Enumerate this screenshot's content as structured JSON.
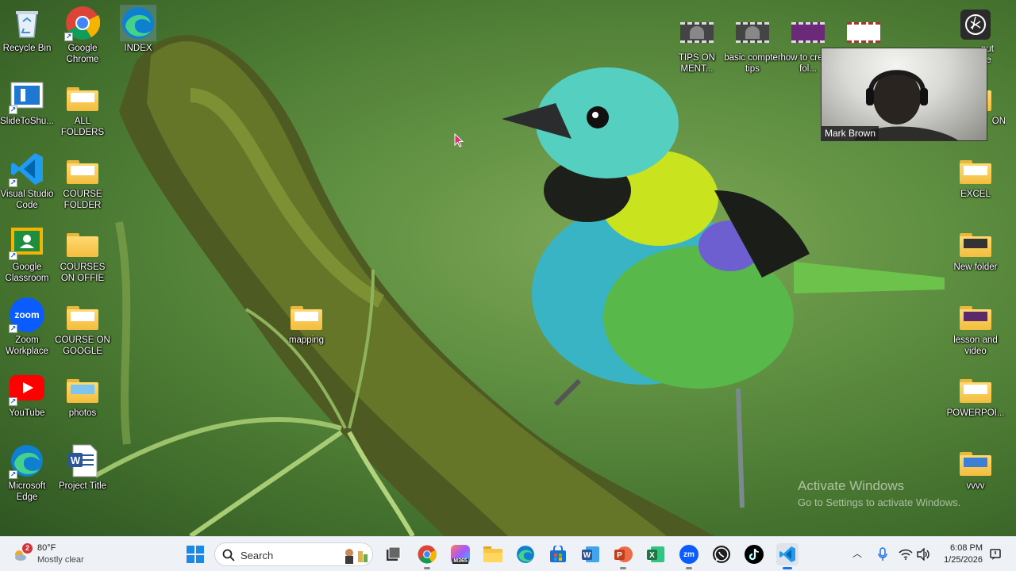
{
  "desktop": {
    "left_column_1": [
      {
        "label": "Recycle Bin",
        "icon": "recycle-bin-icon"
      },
      {
        "label": "SlideToShu...",
        "icon": "slide-to-shutdown-icon"
      },
      {
        "label": "Visual Studio Code",
        "icon": "vscode-icon"
      },
      {
        "label": "Google Classroom",
        "icon": "google-classroom-icon"
      },
      {
        "label": "Zoom Workplace",
        "icon": "zoom-icon"
      },
      {
        "label": "YouTube",
        "icon": "youtube-icon"
      },
      {
        "label": "Microsoft Edge",
        "icon": "edge-icon"
      }
    ],
    "left_column_2": [
      {
        "label": "Google Chrome",
        "icon": "chrome-icon"
      },
      {
        "label": "ALL FOLDERS",
        "icon": "folder-icon"
      },
      {
        "label": "COURSE FOLDER",
        "icon": "folder-icon"
      },
      {
        "label": "COURSES ON OFFIE",
        "icon": "folder-icon"
      },
      {
        "label": "COURSE ON GOOGLE",
        "icon": "folder-icon"
      },
      {
        "label": "photos",
        "icon": "folder-icon"
      },
      {
        "label": "Project Title",
        "icon": "word-document-icon"
      }
    ],
    "index_icon": {
      "label": "INDEX",
      "icon": "edge-icon"
    },
    "middle_icon": {
      "label": "mapping",
      "icon": "folder-icon"
    },
    "top_right_row": [
      {
        "label": "TIPS ON MENT...",
        "icon": "video-thumbnail-icon"
      },
      {
        "label": "basic compter tips",
        "icon": "video-thumbnail-icon"
      },
      {
        "label": "how to create fol...",
        "icon": "video-thumbnail-icon"
      },
      {
        "label": "",
        "icon": "video-thumbnail-icon"
      }
    ],
    "right_column": [
      {
        "label": "ON",
        "icon": "folder-icon"
      },
      {
        "label": "EXCEL",
        "icon": "folder-icon"
      },
      {
        "label": "New folder",
        "icon": "folder-icon"
      },
      {
        "label": "lesson and video",
        "icon": "folder-icon"
      },
      {
        "label": "POWERPOI...",
        "icon": "folder-icon"
      },
      {
        "label": "vvvv",
        "icon": "folder-icon"
      }
    ],
    "partial_right_top_label": "put ire"
  },
  "webcam": {
    "name": "Mark Brown"
  },
  "watermark": {
    "line1": "Activate Windows",
    "line2": "Go to Settings to activate Windows."
  },
  "taskbar": {
    "weather": {
      "badge": "2",
      "temp": "80°F",
      "condition": "Mostly clear"
    },
    "search_placeholder": "Search",
    "pinned": [
      "start-icon",
      "file-manager-icon",
      "chrome-icon",
      "microsoft-365-icon",
      "file-explorer-icon",
      "edge-icon",
      "store-icon",
      "word-icon",
      "powerpoint-icon",
      "excel-icon",
      "zoom-icon",
      "whatsapp-icon",
      "tiktok-icon",
      "vscode-icon"
    ],
    "m365_label": "M365",
    "zoom_label": "zm",
    "clock": {
      "time": "6:08 PM",
      "date": "1/25/2026"
    }
  },
  "colors": {
    "taskbar_bg": "#eef1f6",
    "folder_yellow": "#f3bd3f",
    "word_blue": "#2b579a",
    "excel_green": "#217346",
    "powerpoint_orange": "#c43e1c"
  }
}
